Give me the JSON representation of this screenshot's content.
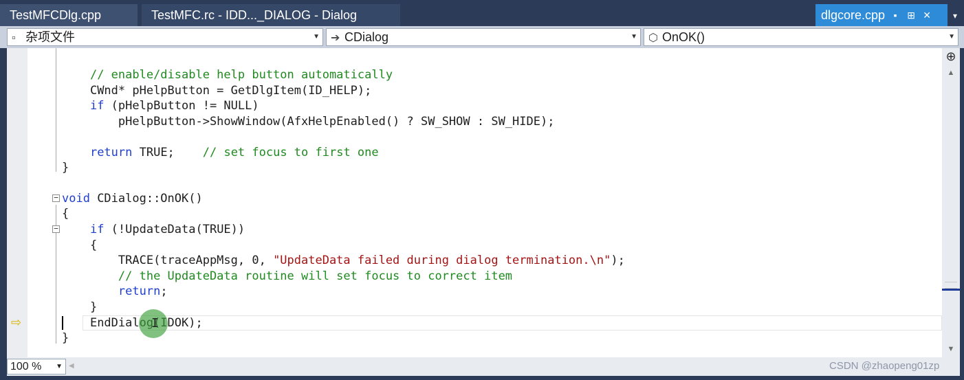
{
  "tabs": {
    "tab1": "TestMFCDlg.cpp",
    "tab2": "TestMFC.rc - IDD..._DIALOG - Dialog",
    "active": "dlgcore.cpp",
    "active_icons": {
      "lock": "▪",
      "pin": "⊞",
      "close": "✕"
    },
    "overflow": "▾"
  },
  "nav": {
    "project_scope": "杂项文件",
    "class_scope": "CDialog",
    "member": "OnOK()"
  },
  "code": {
    "lines": [
      "// enable/disable help button automatically",
      "CWnd* pHelpButton = GetDlgItem(ID_HELP);",
      "if",
      " (pHelpButton != NULL)",
      "pHelpButton->ShowWindow(AfxHelpEnabled() ? SW_SHOW : SW_HIDE);",
      "return",
      " TRUE;",
      "// set focus to first one",
      "}",
      "void",
      " CDialog::OnOK()",
      "{",
      "if",
      " (!UpdateData(TRUE))",
      "{",
      "TRACE(traceAppMsg, 0, ",
      "\"UpdateData failed during dialog termination.\\n\"",
      ");",
      "// the UpdateData routine will set focus to correct item",
      "return",
      ";",
      "}",
      "EndDialog(IDOK);",
      "}"
    ]
  },
  "zoom": "100 %",
  "watermark": "CSDN @zhaopeng01zp",
  "colors": {
    "keyword": "#1e3fcf",
    "comment": "#1f8a1f",
    "string": "#a31515",
    "active_tab": "#2e8bd8",
    "chrome": "#2b3b58"
  }
}
